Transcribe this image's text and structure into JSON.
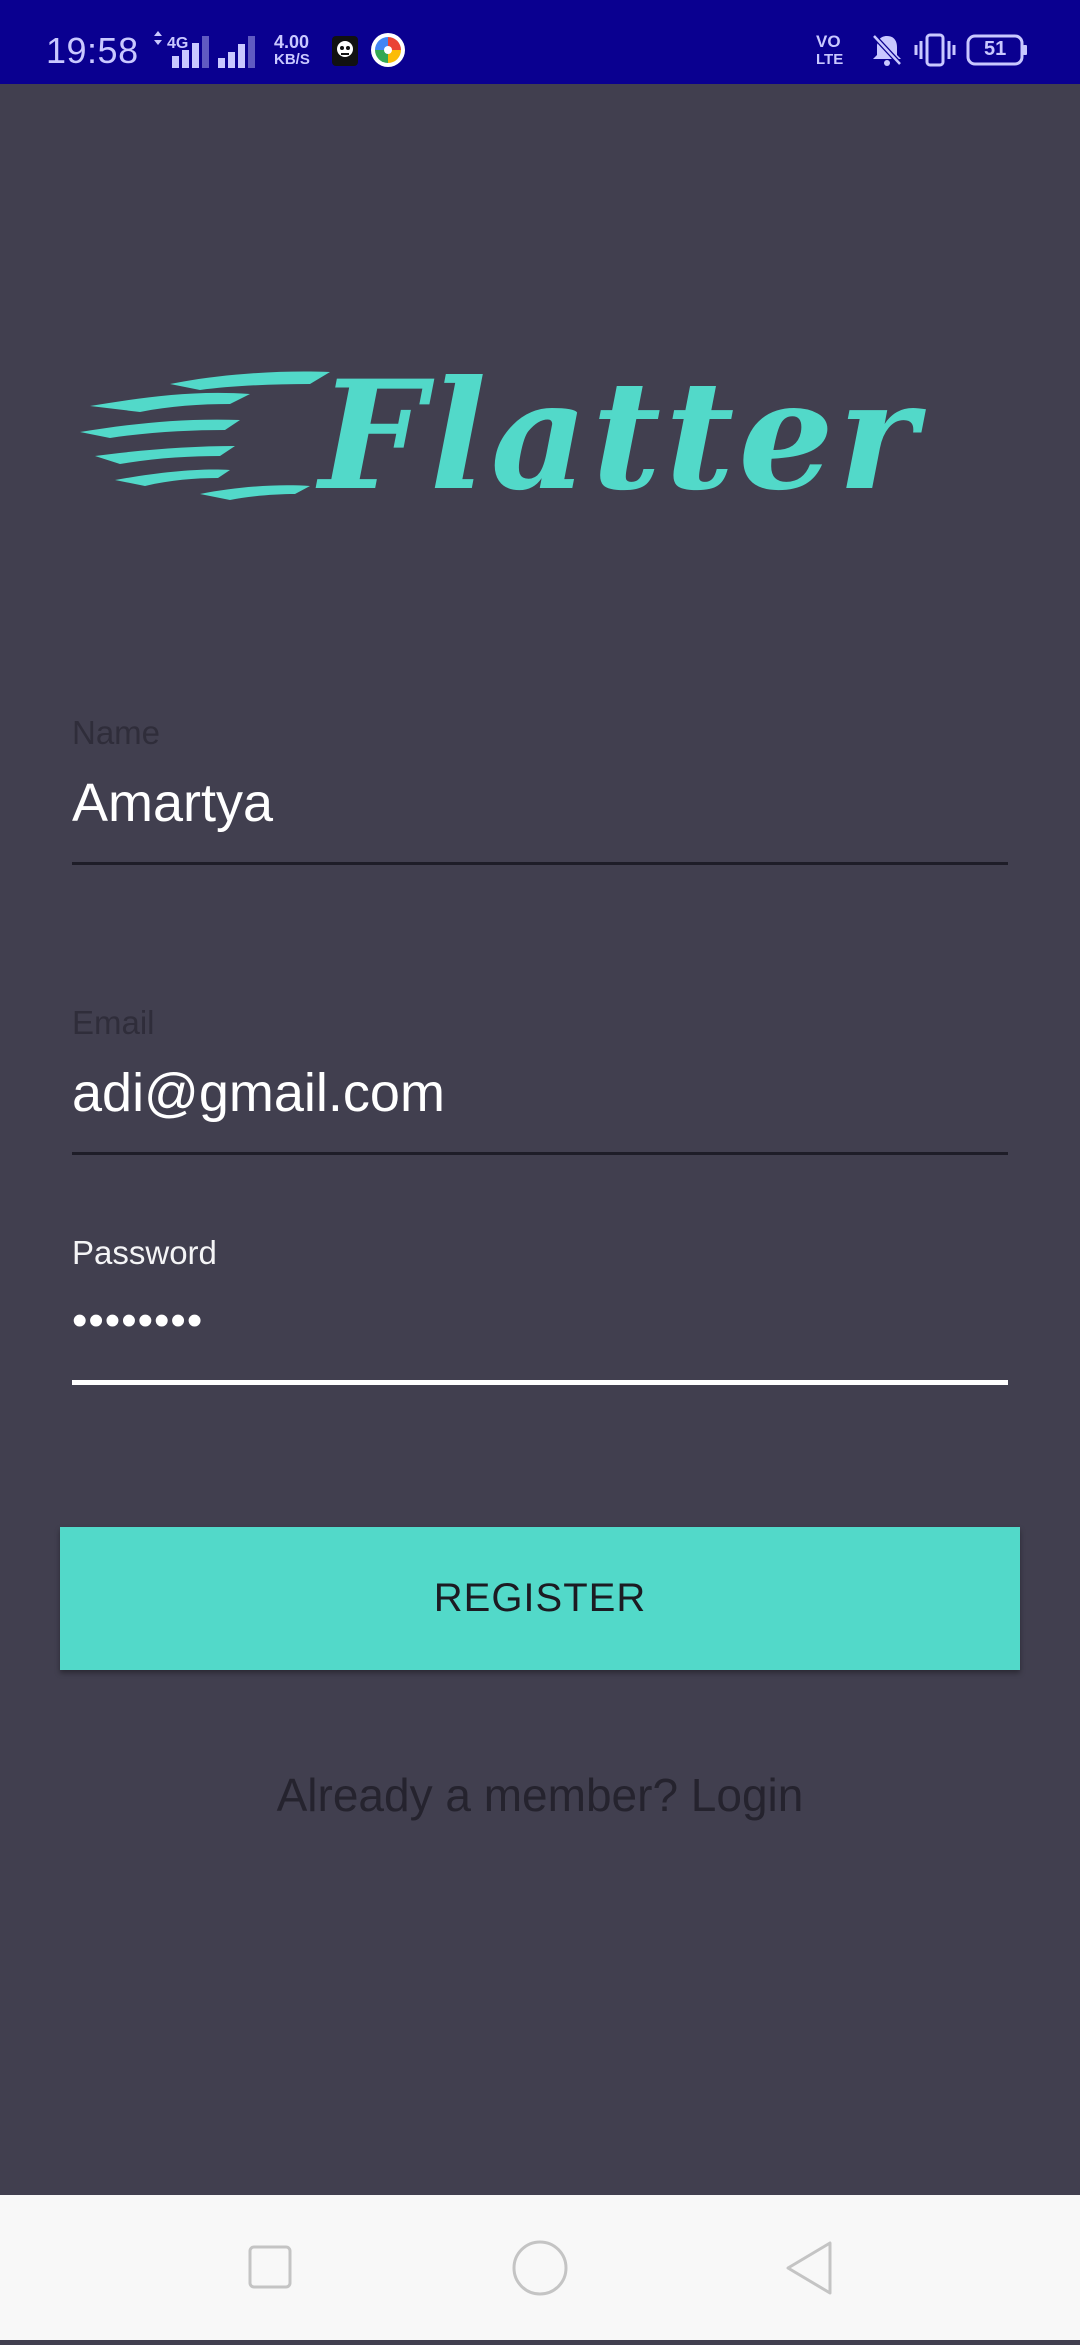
{
  "status_bar": {
    "time": "19:58",
    "network_type": "4G",
    "data_speed_value": "4.00",
    "data_speed_unit": "KB/S",
    "volte_top": "VO",
    "volte_bottom": "LTE",
    "battery": "51",
    "background_color": "#0a0090"
  },
  "app": {
    "logo_text": "Flatter",
    "background_color": "#413f4f",
    "accent_color": "#52d9c9"
  },
  "form": {
    "name": {
      "label": "Name",
      "value": "Amartya"
    },
    "email": {
      "label": "Email",
      "value": "adi@gmail.com"
    },
    "password": {
      "label": "Password",
      "value": "••••••••"
    },
    "register_label": "REGISTER",
    "login_prompt": "Already a member? Login"
  },
  "nav_bar": {
    "recents_icon": "square-icon",
    "home_icon": "circle-icon",
    "back_icon": "triangle-back-icon"
  }
}
